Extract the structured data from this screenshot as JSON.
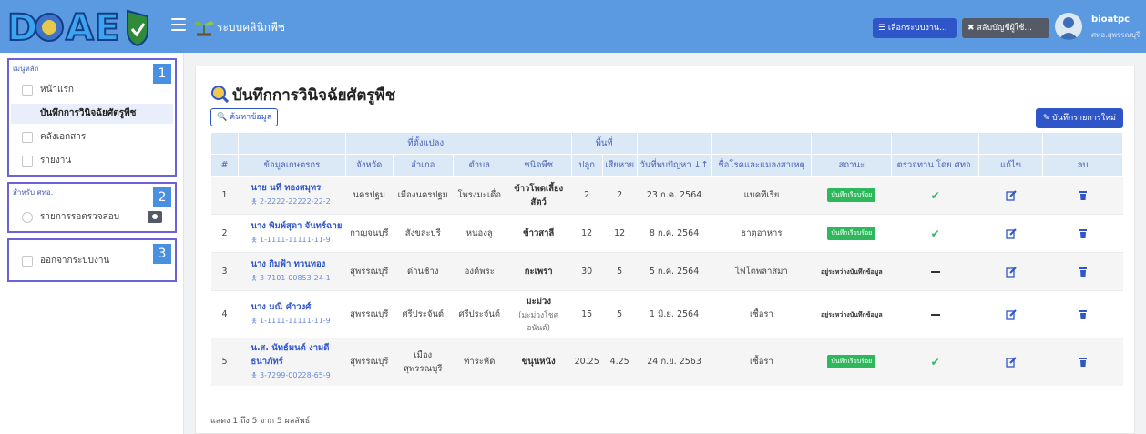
{
  "app": {
    "title": "ระบบคลินิกพืช",
    "logo_text": "DOAE"
  },
  "topbar": {
    "select_system_label": "☰ เลือกระบบงาน...",
    "switch_account_label": "✖ สลับบัญชีผู้ใช้...",
    "user_name": "bioatpc",
    "user_office": "ศทอ.สุพรรณบุรี"
  },
  "sidebar": {
    "section1_title": "เมนูหลัก",
    "section1_number": "1",
    "items1": [
      {
        "label": "หน้าแรก",
        "icon": "home-icon"
      },
      {
        "label": "บันทึกการวินิจฉัยศัตรูพืช",
        "icon": "leaf-icon"
      },
      {
        "label": "คลังเอกสาร",
        "icon": "document-icon"
      },
      {
        "label": "รายงาน",
        "icon": "chart-icon"
      }
    ],
    "section2_title": "สำหรับ ศทอ.",
    "section2_number": "2",
    "items2": [
      {
        "label": "รายการรอตรวจสอบ",
        "icon": "eye-icon"
      }
    ],
    "section3_number": "3",
    "items3": [
      {
        "label": "ออกจากระบบงาน",
        "icon": "logout-icon"
      }
    ]
  },
  "main": {
    "page_title": "บันทึกการวินิจฉัยศัตรูพืช",
    "search_button": "🔍 ค้นหาข้อมูล",
    "new_button": "✎ บันทึกรายการใหม่",
    "group_headers": {
      "plot": "ที่ตั้งแปลง",
      "area": "พื้นที่"
    },
    "columns": [
      "#",
      "ข้อมูลเกษตรกร",
      "จังหวัด",
      "อำเภอ",
      "ตำบล",
      "ชนิดพืช",
      "ปลูก",
      "เสียหาย",
      "วันที่พบปัญหา ↓↑",
      "ชื่อโรคและแมลงสาเหตุ",
      "สถานะ",
      "ตรวจทาน โดย ศทอ.",
      "แก้ไข",
      "ลบ"
    ],
    "rows": [
      {
        "no": "1",
        "name": "นาย นที ทองสมุทร",
        "id": "2-2222-22222-22-2",
        "province": "นครปฐม",
        "district": "เมืองนครปฐม",
        "subdistrict": "โพรงมะเดื่อ",
        "plant": "ข้าวโพดเลี้ยงสัตว์",
        "plant_sub": "",
        "planted": "2",
        "damaged": "2",
        "date": "23 ก.ค. 2564",
        "disease": "แบคทีเรีย",
        "status": "บันทึกเรียบร้อย",
        "status_type": "ok",
        "reviewed": true
      },
      {
        "no": "2",
        "name": "นาง พิมพ์สุดา จันทร์ฉาย",
        "id": "1-1111-11111-11-9",
        "province": "กาญจนบุรี",
        "district": "สังขละบุรี",
        "subdistrict": "หนองลู",
        "plant": "ข้าวสาลี",
        "plant_sub": "",
        "planted": "12",
        "damaged": "12",
        "date": "8 ก.ค. 2564",
        "disease": "ธาตุอาหาร",
        "status": "บันทึกเรียบร้อย",
        "status_type": "ok",
        "reviewed": true
      },
      {
        "no": "3",
        "name": "นาง กิมฟ้า ทวนทอง",
        "id": "3-7101-00853-24-1",
        "province": "สุพรรณบุรี",
        "district": "ด่านช้าง",
        "subdistrict": "องค์พระ",
        "plant": "กะเพรา",
        "plant_sub": "",
        "planted": "30",
        "damaged": "5",
        "date": "5 ก.ค. 2564",
        "disease": "ไฟโตพลาสมา",
        "status": "อยู่ระหว่างบันทึกข้อมูล",
        "status_type": "wait",
        "reviewed": false
      },
      {
        "no": "4",
        "name": "นาง มณี คำวงศ์",
        "id": "1-1111-11111-11-9",
        "province": "สุพรรณบุรี",
        "district": "ศรีประจันต์",
        "subdistrict": "ศรีประจันต์",
        "plant": "มะม่วง",
        "plant_sub": "(มะม่วงโชคอนันต์)",
        "planted": "15",
        "damaged": "5",
        "date": "1 มิ.ย. 2564",
        "disease": "เชื้อรา",
        "status": "อยู่ระหว่างบันทึกข้อมูล",
        "status_type": "wait",
        "reviewed": false
      },
      {
        "no": "5",
        "name": "น.ส. นัทธ์มนต์ งามดีธนาภัทร์",
        "id": "3-7299-00228-65-9",
        "province": "สุพรรณบุรี",
        "district": "เมืองสุพรรณบุรี",
        "subdistrict": "ท่าระหัด",
        "plant": "ขนุนหนัง",
        "plant_sub": "",
        "planted": "20.25",
        "damaged": "4.25",
        "date": "24 ก.ย. 2563",
        "disease": "เชื้อรา",
        "status": "บันทึกเรียบร้อย",
        "status_type": "ok",
        "reviewed": true
      }
    ],
    "footer": "แสดง 1 ถึง 5 จาก 5 ผลลัพธ์"
  }
}
